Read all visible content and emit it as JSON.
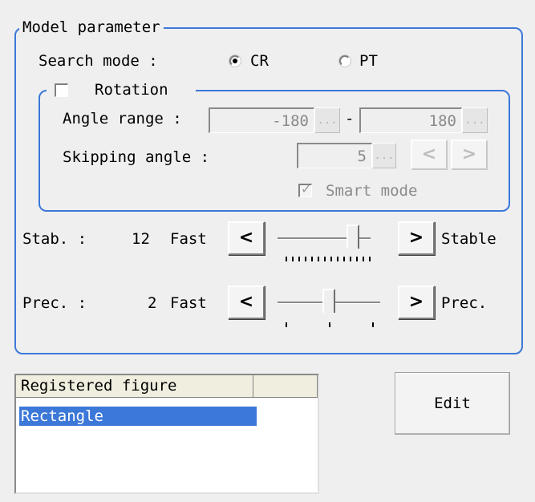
{
  "model_parameter": {
    "title": "Model parameter",
    "search_mode": {
      "label": "Search mode :",
      "options": [
        "CR",
        "PT"
      ],
      "selected": "CR"
    },
    "rotation": {
      "label": "Rotation",
      "checked": false,
      "angle_range": {
        "label": "Angle range :",
        "min": "-180",
        "separator": "-",
        "max": "180",
        "browse": "..."
      },
      "skipping_angle": {
        "label": "Skipping angle :",
        "value": "5",
        "browse": "...",
        "dec": "<",
        "inc": ">"
      },
      "smart_mode": {
        "label": "Smart mode",
        "checked": true
      }
    },
    "stab": {
      "label": "Stab. :",
      "value": "12",
      "left_text": "Fast",
      "right_text": "Stable",
      "dec": "<",
      "inc": ">",
      "level": 0.8
    },
    "prec": {
      "label": "Prec. :",
      "value": "2",
      "left_text": "Fast",
      "right_text": "Prec.",
      "dec": "<",
      "inc": ">",
      "level": 0.5
    }
  },
  "registered_figure": {
    "header": "Registered figure",
    "items": [
      "Rectangle"
    ],
    "selected": "Rectangle"
  },
  "edit_button": "Edit",
  "colors": {
    "accent": "#3c78d8",
    "background": "#efefef",
    "selection": "#3c78d8"
  }
}
